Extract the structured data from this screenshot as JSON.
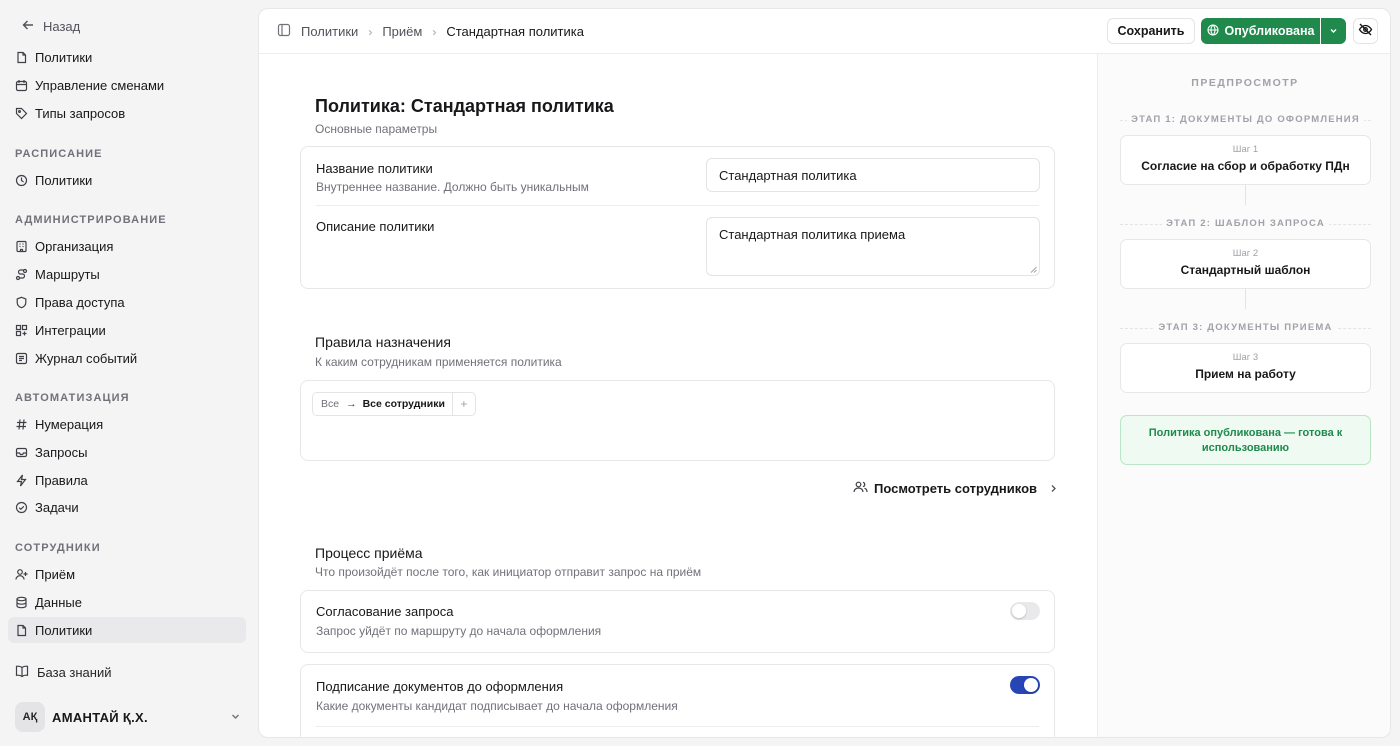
{
  "sidebar": {
    "back_label": "Назад",
    "top_items": [
      {
        "label": "Политики",
        "icon": "document-icon"
      },
      {
        "label": "Управление сменами",
        "icon": "calendar-icon"
      },
      {
        "label": "Типы запросов",
        "icon": "tag-icon"
      }
    ],
    "sections": [
      {
        "title": "РАСПИСАНИЕ",
        "items": [
          {
            "label": "Политики",
            "icon": "clock-icon"
          }
        ]
      },
      {
        "title": "АДМИНИСТРИРОВАНИЕ",
        "items": [
          {
            "label": "Организация",
            "icon": "building-icon"
          },
          {
            "label": "Маршруты",
            "icon": "route-icon"
          },
          {
            "label": "Права доступа",
            "icon": "shield-icon"
          },
          {
            "label": "Интеграции",
            "icon": "grid-plus-icon"
          },
          {
            "label": "Журнал событий",
            "icon": "log-icon"
          }
        ]
      },
      {
        "title": "АВТОМАТИЗАЦИЯ",
        "items": [
          {
            "label": "Нумерация",
            "icon": "hash-icon"
          },
          {
            "label": "Запросы",
            "icon": "inbox-icon"
          },
          {
            "label": "Правила",
            "icon": "bolt-icon"
          },
          {
            "label": "Задачи",
            "icon": "check-circle-icon"
          }
        ]
      },
      {
        "title": "СОТРУДНИКИ",
        "items": [
          {
            "label": "Приём",
            "icon": "user-plus-icon"
          },
          {
            "label": "Данные",
            "icon": "database-icon"
          },
          {
            "label": "Политики",
            "icon": "document-icon",
            "active": true
          }
        ]
      }
    ],
    "knowledge_base": "База знаний",
    "user": {
      "initials": "АҚ",
      "name": "АМАНТАЙ Қ.Х."
    }
  },
  "header": {
    "breadcrumbs": [
      "Политики",
      "Приём",
      "Стандартная политика"
    ],
    "save_label": "Сохранить",
    "publish_label": "Опубликована"
  },
  "page": {
    "title": "Политика: Стандартная политика",
    "subtitle": "Основные параметры",
    "name_field": {
      "label": "Название политики",
      "hint": "Внутреннее название. Должно быть уникальным",
      "value": "Стандартная политика"
    },
    "description_field": {
      "label": "Описание политики",
      "value": "Стандартная политика приема"
    },
    "rules": {
      "title": "Правила назначения",
      "subtitle": "К каким сотрудникам применяется политика",
      "chip_from": "Все",
      "chip_to": "Все сотрудники",
      "view_employees": "Посмотреть сотрудников"
    },
    "process": {
      "title": "Процесс приёма",
      "subtitle": "Что произойдёт после того, как инициатор отправит запрос на приём",
      "approval": {
        "label": "Согласование запроса",
        "hint": "Запрос уйдёт по маршруту до начала оформления",
        "enabled": false
      },
      "signing": {
        "label": "Подписание документов до оформления",
        "hint": "Какие документы кандидат подписывает до начала оформления",
        "enabled": true
      }
    }
  },
  "preview": {
    "title": "ПРЕДПРОСМОТР",
    "stages": [
      {
        "label": "ЭТАП 1: ДОКУМЕНТЫ ДО ОФОРМЛЕНИЯ",
        "step": "Шаг 1",
        "name": "Согласие на сбор и обработку ПДн"
      },
      {
        "label": "ЭТАП 2: ШАБЛОН ЗАПРОСА",
        "step": "Шаг 2",
        "name": "Стандартный шаблон"
      },
      {
        "label": "ЭТАП 3: ДОКУМЕНТЫ ПРИЕМА",
        "step": "Шаг 3",
        "name": "Прием на работу"
      }
    ],
    "status_note": "Политика опубликована — готова к использованию"
  },
  "colors": {
    "accent_green": "#1f8a4c",
    "toggle_on": "#2845b6"
  }
}
